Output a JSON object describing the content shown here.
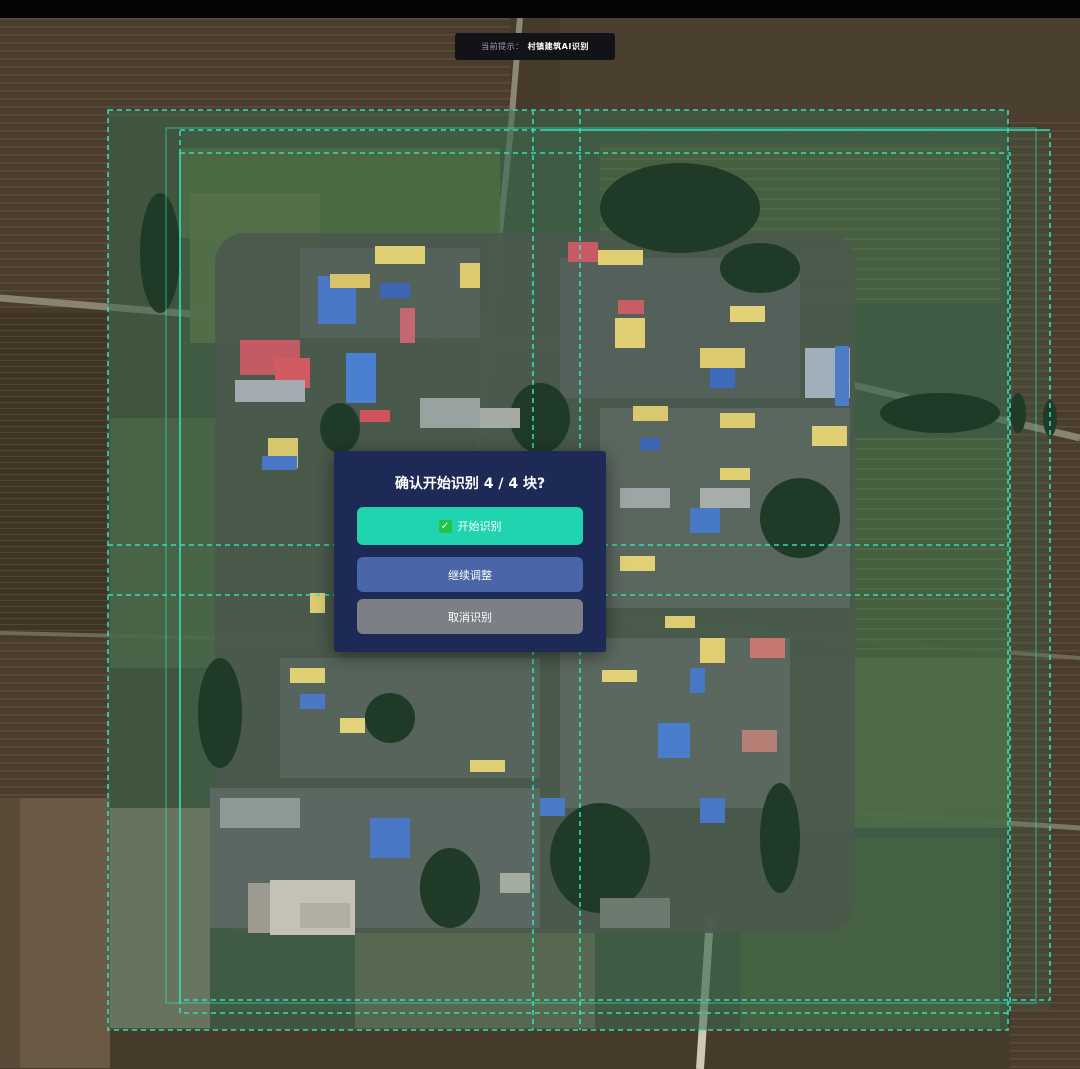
{
  "hint": {
    "label": "当前提示：",
    "value": "村镇建筑AI识别"
  },
  "dialog": {
    "title": "确认开始识别 4 / 4 块?",
    "start_label": "开始识别",
    "adjust_label": "继续调整",
    "cancel_label": "取消识别"
  },
  "colors": {
    "grid_line": "#2fe6c0",
    "dialog_bg": "#1c2a55",
    "start_button": "#1fd4ae",
    "adjust_button": "#4a65a8",
    "cancel_button": "#7d7f86"
  },
  "icons": {
    "start_icon": "check-icon"
  }
}
